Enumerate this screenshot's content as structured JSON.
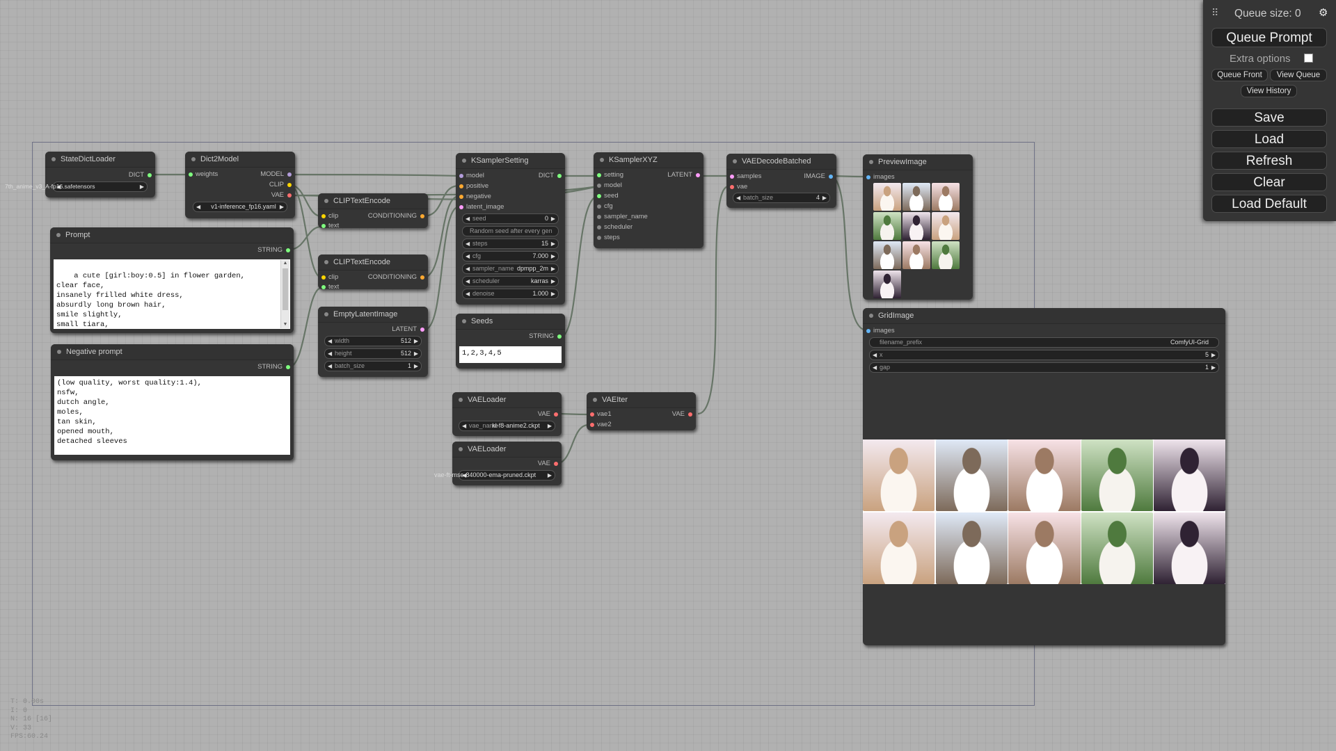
{
  "menu": {
    "queue_size": "Queue size: 0",
    "queue_prompt": "Queue Prompt",
    "extra_options": "Extra options",
    "queue_front": "Queue Front",
    "view_queue": "View Queue",
    "view_history": "View History",
    "save": "Save",
    "load": "Load",
    "refresh": "Refresh",
    "clear": "Clear",
    "load_default": "Load Default"
  },
  "stats": {
    "t": "T: 0.00s",
    "i": "I: 0",
    "n": "N: 16 [16]",
    "v": "V: 33",
    "fps": "FPS:60.24"
  },
  "nodes": {
    "state_dict_loader": {
      "title": "StateDictLoader",
      "out_dict": "DICT",
      "ckpt": "7th_anime_v3_A-fp16.safetensors"
    },
    "dict2model": {
      "title": "Dict2Model",
      "in_weights": "weights",
      "out_model": "MODEL",
      "out_clip": "CLIP",
      "out_vae": "VAE",
      "config": "v1-inference_fp16.yaml"
    },
    "prompt": {
      "title": "Prompt",
      "out_string": "STRING",
      "text": "a cute [girl:boy:0.5] in flower garden,\nclear face,\ninsanely frilled white dress,\nabsurdly long brown hair,\nsmile slightly,\nsmall tiara,\nlong sleeves highneck dress"
    },
    "negative_prompt": {
      "title": "Negative prompt",
      "out_string": "STRING",
      "text": "(low quality, worst quality:1.4),\nnsfw,\ndutch angle,\nmoles,\ntan skin,\nopened mouth,\ndetached sleeves"
    },
    "clip1": {
      "title": "CLIPTextEncode",
      "in_clip": "clip",
      "in_text": "text",
      "out": "CONDITIONING"
    },
    "clip2": {
      "title": "CLIPTextEncode",
      "in_clip": "clip",
      "in_text": "text",
      "out": "CONDITIONING"
    },
    "empty_latent": {
      "title": "EmptyLatentImage",
      "out": "LATENT",
      "width_lbl": "width",
      "width": "512",
      "height_lbl": "height",
      "height": "512",
      "batch_lbl": "batch_size",
      "batch": "1"
    },
    "ksampler_setting": {
      "title": "KSamplerSetting",
      "in_model": "model",
      "in_positive": "positive",
      "in_negative": "negative",
      "in_latent": "latent_image",
      "out": "DICT",
      "seed_lbl": "seed",
      "seed": "0",
      "control": "Random seed after every gen",
      "steps_lbl": "steps",
      "steps": "15",
      "cfg_lbl": "cfg",
      "cfg": "7.000",
      "sampler_lbl": "sampler_name",
      "sampler": "dpmpp_2m",
      "scheduler_lbl": "scheduler",
      "scheduler": "karras",
      "denoise_lbl": "denoise",
      "denoise": "1.000"
    },
    "seeds": {
      "title": "Seeds",
      "out": "STRING",
      "text": "1,2,3,4,5"
    },
    "ksampler_xyz": {
      "title": "KSamplerXYZ",
      "in_setting": "setting",
      "out": "LATENT",
      "in_model": "model",
      "in_seed": "seed",
      "in_cfg": "cfg",
      "in_sampler": "sampler_name",
      "in_scheduler": "scheduler",
      "in_steps": "steps"
    },
    "vae_decode_batched": {
      "title": "VAEDecodeBatched",
      "in_samples": "samples",
      "in_vae": "vae",
      "out": "IMAGE",
      "batch_lbl": "batch_size",
      "batch": "4"
    },
    "preview_image": {
      "title": "PreviewImage",
      "in_images": "images"
    },
    "vae_loader1": {
      "title": "VAELoader",
      "out": "VAE",
      "name_lbl": "vae_name",
      "name": "kl-f8-anime2.ckpt"
    },
    "vae_loader2": {
      "title": "VAELoader",
      "out": "VAE",
      "name": "vae-ft-mse-840000-ema-pruned.ckpt"
    },
    "vae_iter": {
      "title": "VAEIter",
      "in_vae1": "vae1",
      "in_vae2": "vae2",
      "out": "VAE"
    },
    "grid_image": {
      "title": "GridImage",
      "in_images": "images",
      "prefix_lbl": "filename_prefix",
      "prefix": "ComfyUI-Grid",
      "x_lbl": "x",
      "x": "5",
      "gap_lbl": "gap",
      "gap": "1"
    }
  },
  "colors": {
    "model": "#b39ddb",
    "clip": "#ffd500",
    "vae": "#ff6e6e",
    "conditioning": "#ffa931",
    "latent": "#ff9cf9",
    "image": "#64b5f6",
    "string": "#7fff7f",
    "generic": "#888888",
    "wire": "#6b7a6b"
  }
}
